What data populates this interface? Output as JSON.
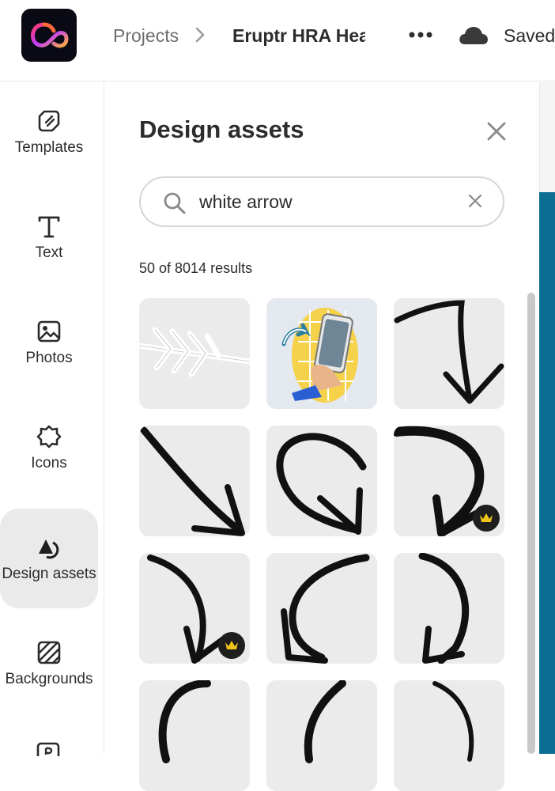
{
  "header": {
    "breadcrumb_projects": "Projects",
    "document_title": "Eruptr HRA Head",
    "save_status": "Saved"
  },
  "rail": {
    "items": [
      {
        "label": "Templates",
        "icon": "templates-icon"
      },
      {
        "label": "Text",
        "icon": "text-icon"
      },
      {
        "label": "Photos",
        "icon": "photos-icon"
      },
      {
        "label": "Icons",
        "icon": "icons-icon"
      },
      {
        "label": "Design assets",
        "icon": "design-assets-icon",
        "active": true
      },
      {
        "label": "Backgrounds",
        "icon": "backgrounds-icon"
      }
    ]
  },
  "panel": {
    "title": "Design assets",
    "search_value": "white arrow",
    "results_count": "50 of 8014 results"
  },
  "colors": {
    "accent_blue": "#0b6e92",
    "premium_crown": "#f0c419",
    "tile_bg": "#ebebeb"
  }
}
